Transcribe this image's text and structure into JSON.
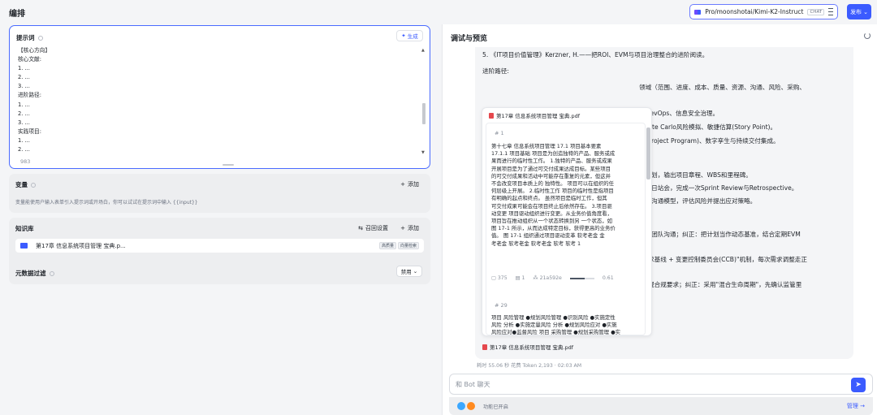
{
  "header": {
    "title": "编排",
    "model_name": "Pro/moonshotai/Kimi-K2-Instruct",
    "model_tag": "CHAT",
    "publish_label": "发布"
  },
  "prompt": {
    "title": "提示词",
    "generate_label": "生成",
    "lines": [
      "【核心方向】",
      "核心文献:",
      "1. ...",
      "2. ...",
      "3. ...",
      "进阶路径:",
      "1. ...",
      "2. ...",
      "3. ...",
      "实践项目:",
      "1. ...",
      "2. ..."
    ],
    "char_count": "983"
  },
  "variables": {
    "title": "变量",
    "add_label": "添加",
    "description": "变量能使用户输入表单引入提示词或开场白，你可以试试在提示词中输入 {{input}}"
  },
  "knowledge": {
    "title": "知识库",
    "recall_label": "召回设置",
    "add_label": "添加",
    "item_name": "第17章 信息系统项目管理 宝典.p...",
    "tags": [
      "高质量",
      "向量检索"
    ],
    "meta_filter_label": "元数据过滤",
    "meta_filter_value": "禁用"
  },
  "preview": {
    "title": "调试与预览",
    "lines_top": [
      "5. 《IT项目价值管理》Kerzner, H.——把ROI、EVM与项目治理整合的进阶阅读。",
      "进阶路径:"
    ],
    "lines_right": [
      "领域（范围、进度、成本、质量、资源、沟通、风险、采购、",
      "、DevOps、信息安全治理。",
      " Monte Carlo风险模拟、敏捷估算(Story Point)。",
      "群(Project Program)、数字孪生与持续交付集成。",
      "指规划，输出项目章程、WBS和里程碑。",
      "办每日站会，完成一次Sprint Review与Retrospective。",
      "阵和沟通模型，评估风险并提出应对策略。",
      "制和团队沟通；纠正：把计划当作动态基准，结合定期EVM",
      "\"需求基线 + 变更控制委员会(CCB)\"机制，每次需求调整走正",
      "\"忽视合规要求；纠正：采用\"混合生命周期\"，先确认监管里"
    ],
    "reference": {
      "file_name": "第17章 信息系统项目管理 宝典.pdf",
      "chunk1_id": "# 1",
      "chunk1_lines": [
        "第十七章 信息系统项目管理 17.1 项目基本要素",
        "17.1.1 项目基础 项目是为创造独特的产品、服务或成",
        "果而进行的临时性工作。 1.独特的产品、服务或成果",
        "开展项目是为了通过可交付成果达成目标。某些项目",
        "的可交付成果和活动中可能存在重复的元素，但这并",
        "不会改变项目本质上的 独特性。 项目可以在组织的任",
        "何层级上开展。 2.临时性工作 项目的临时性是指项目",
        "有明确的起点和终点。 虽然项目是临时工作，但其",
        "可交付成果可能会在项目终止后依然存在。 3.项目驱",
        "动变更 项目驱动组织进行变更。从业务价值角度看，",
        "项目旨在推动组织从一个状态转换到另 一个状态，如",
        "图 17-1 所示，从而达成特定目标，获得更高的业务价",
        "值。 图 17-1 组织通过项目驱动变革 软考老金 金",
        "考老金 软考老金 软考老金 软考 软考 1"
      ],
      "chunk1_chars": "375",
      "chunk1_hits": "1",
      "chunk1_hash": "21a592e",
      "chunk1_score": "0.61",
      "chunk1_score_fraction": 0.61,
      "chunk2_id": "# 29",
      "chunk2_lines": [
        "项目 风险管理 ●规划风险管理 ●识别风险 ●实施定性",
        "风险 分析 ●实施定量风险 分析 ●规划风险应对 ●实施",
        "风险应对●监督风险 项目 采购管理 ●规划采购管理 ●实"
      ]
    },
    "source_file": "第17章 信息系统项目管理 宝典.pdf",
    "stats": "耗时 55.06 秒  花费 Token 2,193  ·  02:03 AM",
    "input_placeholder": "和 Bot 聊天",
    "features_text": "功能已开启",
    "manage_label": "管理 →"
  },
  "colors": {
    "accent": "#3b5bff",
    "pdf_red": "#e5484d"
  }
}
